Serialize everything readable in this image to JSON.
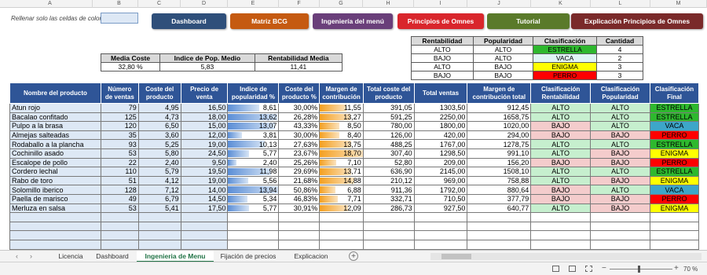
{
  "columns": [
    "A",
    "B",
    "C",
    "D",
    "E",
    "F",
    "G",
    "H",
    "I",
    "J",
    "K",
    "L",
    "M"
  ],
  "hint": "Rellenar solo las celdas de color",
  "buttons": [
    {
      "label": "Dashboard",
      "color": "#2f4f7a"
    },
    {
      "label": "Matriz BCG",
      "color": "#c55a11"
    },
    {
      "label": "Ingeniería del menú",
      "color": "#6a3f7a"
    },
    {
      "label": "Principios de Omnes",
      "color": "#d9262c"
    },
    {
      "label": "Tutorial",
      "color": "#5a7a2a"
    },
    {
      "label": "Explicación Principios de Omnes",
      "color": "#7a2a2a"
    }
  ],
  "summary": {
    "headers": [
      "Media Coste",
      "Indice de Pop. Medio",
      "Rentabilidad Media"
    ],
    "values": [
      "32,80 %",
      "5,83",
      "11,41"
    ]
  },
  "classif": {
    "headers": [
      "Rentabilidad",
      "Popularidad",
      "Clasificación",
      "Cantidad"
    ],
    "rows": [
      [
        "ALTO",
        "ALTO",
        "ESTRELLA",
        "4"
      ],
      [
        "BAJO",
        "ALTO",
        "VACA",
        "2"
      ],
      [
        "ALTO",
        "BAJO",
        "ENIGMA",
        "3"
      ],
      [
        "BAJO",
        "BAJO",
        "PERRO",
        "3"
      ]
    ],
    "colors": [
      "#2eb82e",
      "#e0f5f5",
      "#ffff00",
      "#ff0000"
    ]
  },
  "main": {
    "headers": [
      "Nombre del producto",
      "Número de ventas",
      "Coste del producto",
      "Precio de venta",
      "Indice de popularidad %",
      "Coste del producto %",
      "Margen de contribución",
      "Total coste del producto",
      "Total ventas",
      "Margen de contribución total",
      "Clasificación Rentabilidad",
      "Clasificación Popularidad",
      "Clasificación Final"
    ],
    "rows": [
      [
        "Atun rojo",
        "79",
        "4,95",
        "16,50",
        "8,61",
        "30,00%",
        "11,55",
        "391,05",
        "1303,50",
        "912,45",
        "ALTO",
        "ALTO",
        "ESTRELLA"
      ],
      [
        "Bacalao confitado",
        "125",
        "4,73",
        "18,00",
        "13,62",
        "26,28%",
        "13,27",
        "591,25",
        "2250,00",
        "1658,75",
        "ALTO",
        "ALTO",
        "ESTRELLA"
      ],
      [
        "Pulpo a la brasa",
        "120",
        "6,50",
        "15,00",
        "13,07",
        "43,33%",
        "8,50",
        "780,00",
        "1800,00",
        "1020,00",
        "BAJO",
        "ALTO",
        "VACA"
      ],
      [
        "Almejas salteadas",
        "35",
        "3,60",
        "12,00",
        "3,81",
        "30,00%",
        "8,40",
        "126,00",
        "420,00",
        "294,00",
        "BAJO",
        "BAJO",
        "PERRO"
      ],
      [
        "Rodaballo a la plancha",
        "93",
        "5,25",
        "19,00",
        "10,13",
        "27,63%",
        "13,75",
        "488,25",
        "1767,00",
        "1278,75",
        "ALTO",
        "ALTO",
        "ESTRELLA"
      ],
      [
        "Cochinillo asado",
        "53",
        "5,80",
        "24,50",
        "5,77",
        "23,67%",
        "18,70",
        "307,40",
        "1298,50",
        "991,10",
        "ALTO",
        "BAJO",
        "ENIGMA"
      ],
      [
        "Escalope de pollo",
        "22",
        "2,40",
        "9,50",
        "2,40",
        "25,26%",
        "7,10",
        "52,80",
        "209,00",
        "156,20",
        "BAJO",
        "BAJO",
        "PERRO"
      ],
      [
        "Cordero lechal",
        "110",
        "5,79",
        "19,50",
        "11,98",
        "29,69%",
        "13,71",
        "636,90",
        "2145,00",
        "1508,10",
        "ALTO",
        "ALTO",
        "ESTRELLA"
      ],
      [
        "Rabo de toro",
        "51",
        "4,12",
        "19,00",
        "5,56",
        "21,68%",
        "14,88",
        "210,12",
        "969,00",
        "758,88",
        "ALTO",
        "BAJO",
        "ENIGMA"
      ],
      [
        "Solomillo iberico",
        "128",
        "7,12",
        "14,00",
        "13,94",
        "50,86%",
        "6,88",
        "911,36",
        "1792,00",
        "880,64",
        "BAJO",
        "ALTO",
        "VACA"
      ],
      [
        "Paella de marisco",
        "49",
        "6,79",
        "14,50",
        "5,34",
        "46,83%",
        "7,71",
        "332,71",
        "710,50",
        "377,79",
        "BAJO",
        "BAJO",
        "PERRO"
      ],
      [
        "Merluza en salsa",
        "53",
        "5,41",
        "17,50",
        "5,77",
        "30,91%",
        "12,09",
        "286,73",
        "927,50",
        "640,77",
        "ALTO",
        "BAJO",
        "ENIGMA"
      ]
    ],
    "popularity_max": 13.94,
    "margin_max": 18.7
  },
  "sheet_tabs": [
    "Licencia",
    "Dashboard",
    "Ingenieria de Menu",
    "Fijación de precios",
    "Explicacion"
  ],
  "active_tab": "Ingenieria de Menu",
  "zoom": "70 %"
}
